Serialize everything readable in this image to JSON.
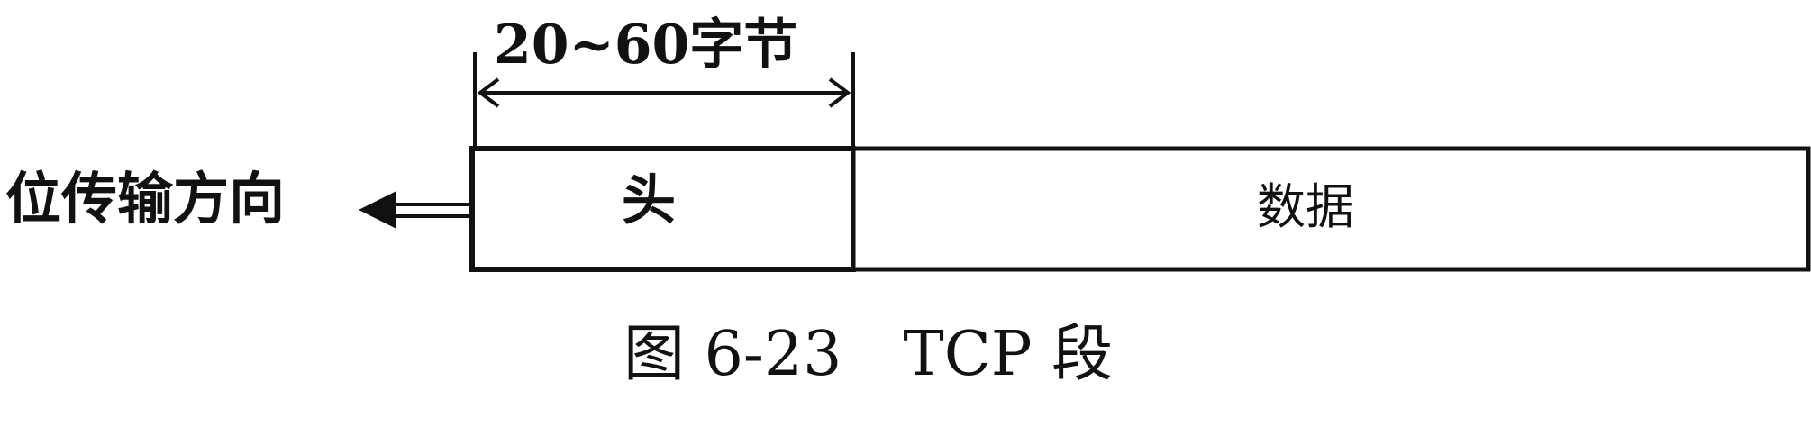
{
  "figure": {
    "size_label": "20~60字节",
    "direction_label": "位传输方向",
    "header_label": "头",
    "data_label": "数据",
    "caption": "图 6-23　TCP 段"
  },
  "colors": {
    "ink": "#111111",
    "background": "#ffffff"
  }
}
